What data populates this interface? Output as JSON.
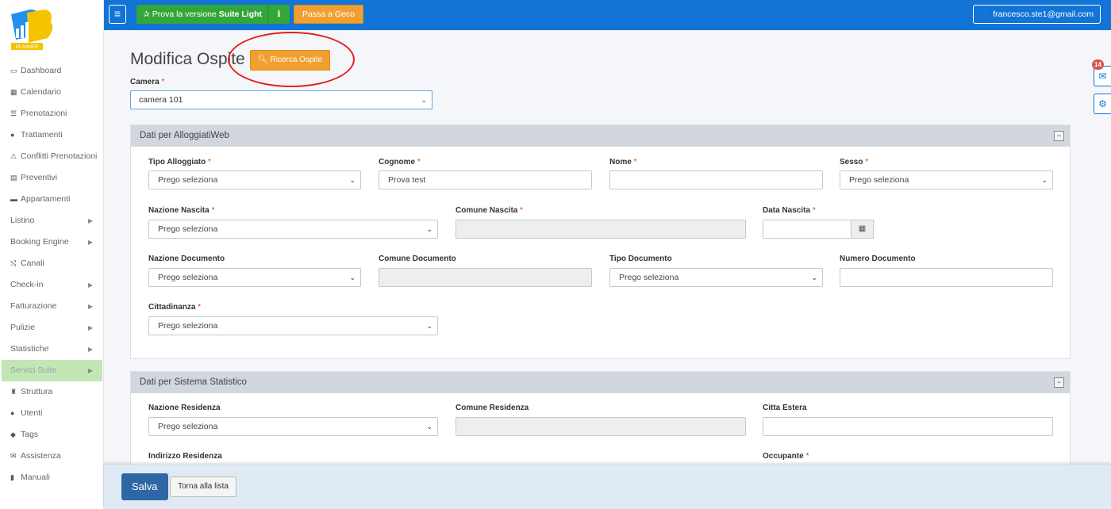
{
  "sidebar": {
    "logo_text": "PLANNER",
    "items": [
      {
        "label": "Dashboard",
        "icon": "▭",
        "caret": false
      },
      {
        "label": "Calendario",
        "icon": "▦",
        "caret": false
      },
      {
        "label": "Prenotazioni",
        "icon": "☰",
        "caret": false
      },
      {
        "label": "Trattamenti",
        "icon": "●",
        "caret": false
      },
      {
        "label": "Conflitti Prenotazioni",
        "icon": "⚠",
        "caret": false
      },
      {
        "label": "Preventivi",
        "icon": "▤",
        "caret": false
      },
      {
        "label": "Appartamenti",
        "icon": "▬",
        "caret": false
      },
      {
        "label": "Listino",
        "icon": "",
        "caret": true
      },
      {
        "label": "Booking Engine",
        "icon": "",
        "caret": true
      },
      {
        "label": "Canali",
        "icon": "⤭",
        "caret": false
      },
      {
        "label": "Check-in",
        "icon": "",
        "caret": true
      },
      {
        "label": "Fatturazione",
        "icon": "",
        "caret": true
      },
      {
        "label": "Pulizie",
        "icon": "",
        "caret": true
      },
      {
        "label": "Statistiche",
        "icon": "",
        "caret": true
      },
      {
        "label": "Servizi Suite",
        "icon": "",
        "caret": true,
        "active": true
      },
      {
        "label": "Struttura",
        "icon": "♜",
        "caret": false
      },
      {
        "label": "Utenti",
        "icon": "●",
        "caret": false
      },
      {
        "label": "Tags",
        "icon": "◆",
        "caret": false
      },
      {
        "label": "Assistenza",
        "icon": "✉",
        "caret": false
      },
      {
        "label": "Manuali",
        "icon": "▮",
        "caret": false
      }
    ]
  },
  "topbar": {
    "suite_prefix": "Prova la versione",
    "suite_bold": "Suite Light",
    "info_icon": "ℹ",
    "geco_label": "Passa a Geco",
    "user_email": "francesco.ste1@gmail.com"
  },
  "page": {
    "title": "Modifica Ospite",
    "search_button": "Ricerca Ospite",
    "camera_label": "Camera",
    "camera_value": "camera 101"
  },
  "panel1": {
    "title": "Dati per AlloggiatiWeb",
    "fields": {
      "tipo_alloggiato": {
        "label": "Tipo Alloggiato",
        "value": "Prego seleziona"
      },
      "cognome": {
        "label": "Cognome",
        "value": "Prova test"
      },
      "nome": {
        "label": "Nome",
        "value": ""
      },
      "sesso": {
        "label": "Sesso",
        "value": "Prego seleziona"
      },
      "nazione_nascita": {
        "label": "Nazione Nascita",
        "value": "Prego seleziona"
      },
      "comune_nascita": {
        "label": "Comune Nascita",
        "value": ""
      },
      "data_nascita": {
        "label": "Data Nascita",
        "value": ""
      },
      "nazione_documento": {
        "label": "Nazione Documento",
        "value": "Prego seleziona"
      },
      "comune_documento": {
        "label": "Comune Documento",
        "value": ""
      },
      "tipo_documento": {
        "label": "Tipo Documento",
        "value": "Prego seleziona"
      },
      "numero_documento": {
        "label": "Numero Documento",
        "value": ""
      },
      "cittadinanza": {
        "label": "Cittadinanza",
        "value": "Prego seleziona"
      }
    }
  },
  "panel2": {
    "title": "Dati per Sistema Statistico",
    "fields": {
      "nazione_residenza": {
        "label": "Nazione Residenza",
        "value": "Prego seleziona"
      },
      "comune_residenza": {
        "label": "Comune Residenza",
        "value": ""
      },
      "citta_estera": {
        "label": "Citta Estera",
        "value": ""
      },
      "indirizzo_residenza": {
        "label": "Indirizzo Residenza"
      },
      "occupante": {
        "label": "Occupante"
      }
    }
  },
  "footer": {
    "save_label": "Salva",
    "back_label": "Torna alla lista"
  },
  "widgets": {
    "mail_badge": "14"
  },
  "colors": {
    "topbar": "#1274d6",
    "accent_orange": "#f0a030",
    "green": "#33a63a",
    "save": "#2d67a4"
  }
}
